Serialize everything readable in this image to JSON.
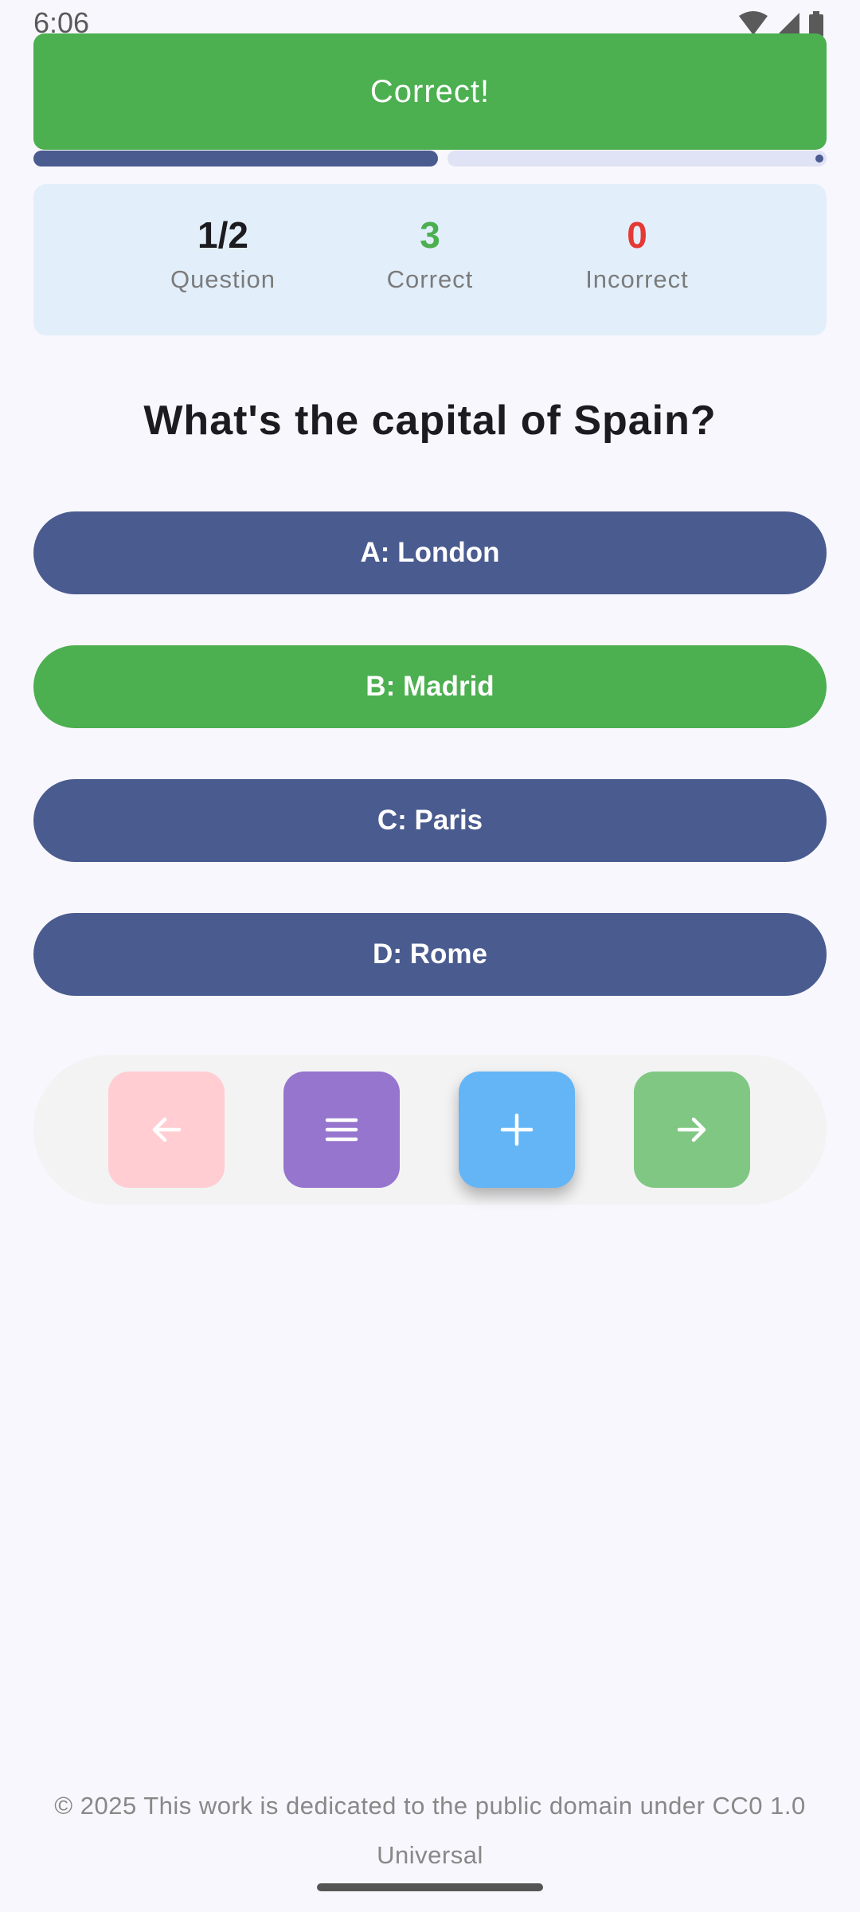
{
  "status_bar": {
    "time": "6:06"
  },
  "banner": {
    "message": "Correct!",
    "color": "#4caf50"
  },
  "progress": {
    "fraction": 0.51
  },
  "stats": {
    "question": {
      "value": "1/2",
      "label": "Question"
    },
    "correct": {
      "value": "3",
      "label": "Correct",
      "color": "#4caf50"
    },
    "incorrect": {
      "value": "0",
      "label": "Incorrect",
      "color": "#e53935"
    }
  },
  "question_text": "What's the capital of Spain?",
  "answers": [
    {
      "label": "A: London",
      "state": "default"
    },
    {
      "label": "B: Madrid",
      "state": "correct"
    },
    {
      "label": "C: Paris",
      "state": "default"
    },
    {
      "label": "D: Rome",
      "state": "default"
    }
  ],
  "toolbar": {
    "buttons": [
      {
        "icon": "arrow-left-icon",
        "name": "previous-button",
        "color": "#ffcdd2"
      },
      {
        "icon": "menu-icon",
        "name": "menu-button",
        "color": "#9575cd"
      },
      {
        "icon": "plus-icon",
        "name": "add-button",
        "color": "#64b5f6"
      },
      {
        "icon": "arrow-right-icon",
        "name": "next-button",
        "color": "#81c784"
      }
    ]
  },
  "colors": {
    "primary": "#4a5b8f",
    "correct": "#4caf50"
  },
  "footer": {
    "text": "© 2025 This work is dedicated to the public domain under CC0 1.0 Universal"
  }
}
